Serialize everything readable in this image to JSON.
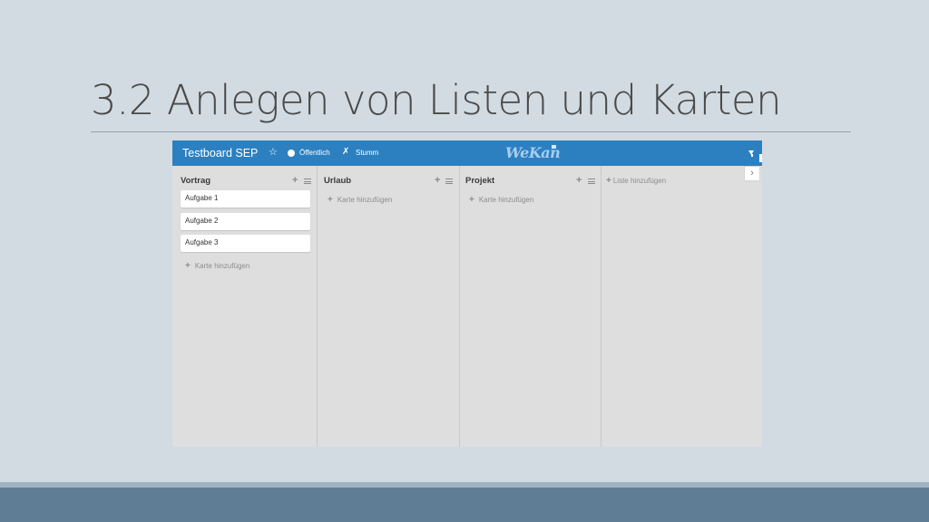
{
  "slide": {
    "title": "3.2 Anlegen von Listen und Karten"
  },
  "app": {
    "board_title": "Testboard SEP",
    "visibility_label": "Öffentlich",
    "mute_label": "Stumm",
    "logo_text": "WeKan",
    "accent_color": "#2c80c0",
    "icons": [
      "star-icon",
      "globe-icon",
      "mute-icon",
      "filter-icon",
      "chevron-right-icon",
      "plus-icon",
      "hamburger-menu-icon"
    ]
  },
  "lists": [
    {
      "title": "Vortrag",
      "cards": [
        "Aufgabe 1",
        "Aufgabe 2",
        "Aufgabe 3"
      ],
      "add_card": "Karte hinzufügen"
    },
    {
      "title": "Urlaub",
      "cards": [],
      "add_card": "Karte hinzufügen"
    },
    {
      "title": "Projekt",
      "cards": [],
      "add_card": "Karte hinzufügen"
    }
  ],
  "add_list": "Liste hinzufügen"
}
